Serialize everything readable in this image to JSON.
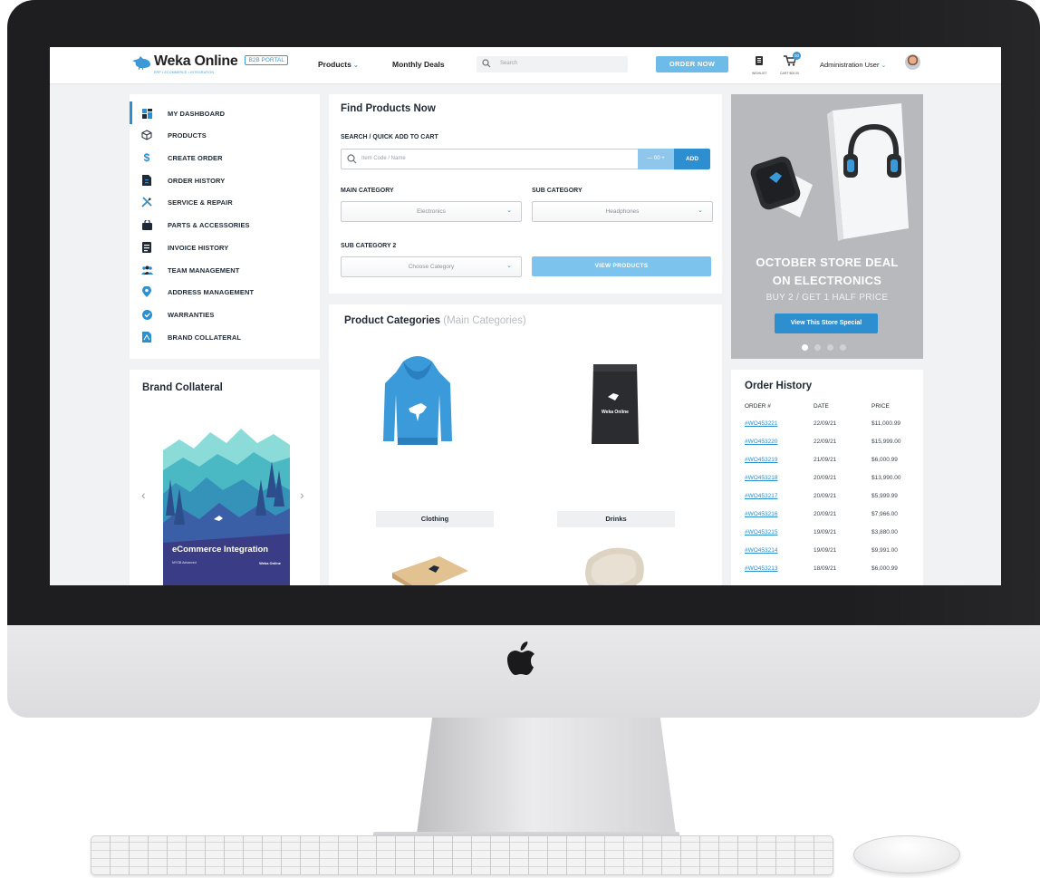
{
  "header": {
    "logo_text": "Weka Online",
    "logo_tagline": "ERP • ECOMMERCE • INTEGRATION",
    "portal_badge": "B2B PORTAL",
    "nav_products": "Products",
    "nav_monthly_deals": "Monthly Deals",
    "search_placeholder": "Search",
    "order_now": "ORDER NOW",
    "wishlist_label": "WISHLIST",
    "cart_label": "CART $00.00",
    "cart_count": "00",
    "user_name": "Administration User"
  },
  "sidebar": {
    "items": [
      {
        "label": "MY DASHBOARD",
        "icon": "dashboard-icon"
      },
      {
        "label": "PRODUCTS",
        "icon": "box-icon"
      },
      {
        "label": "CREATE ORDER",
        "icon": "dollar-icon"
      },
      {
        "label": "ORDER HISTORY",
        "icon": "document-icon"
      },
      {
        "label": "SERVICE & REPAIR",
        "icon": "tools-icon"
      },
      {
        "label": "PARTS & ACCESSORIES",
        "icon": "bag-icon"
      },
      {
        "label": "INVOICE HISTORY",
        "icon": "invoice-icon"
      },
      {
        "label": "TEAM MANAGEMENT",
        "icon": "team-icon"
      },
      {
        "label": "ADDRESS MANAGEMENT",
        "icon": "location-pin-icon"
      },
      {
        "label": "WARRANTIES",
        "icon": "check-circle-icon"
      },
      {
        "label": "BRAND COLLATERAL",
        "icon": "pdf-icon"
      }
    ]
  },
  "brand_collateral": {
    "title": "Brand Collateral",
    "poster_caption": "eCommerce Integration",
    "poster_subtext": "MYOB Advanced",
    "poster_logo": "Weka Online"
  },
  "find_products": {
    "title": "Find Products Now",
    "search_label": "SEARCH / QUICK ADD TO CART",
    "search_placeholder": "Item Code / Name",
    "qty_text": "—  00  +",
    "add_label": "ADD",
    "main_category_label": "MAIN CATEGORY",
    "main_category_value": "Electronics",
    "sub_category_label": "SUB CATEGORY",
    "sub_category_value": "Headphones",
    "sub_category2_label": "SUB CATEGORY 2",
    "sub_category2_value": "Choose Category",
    "view_products": "VIEW PRODUCTS"
  },
  "product_categories": {
    "title": "Product Categories",
    "subtitle": "(Main Categories)",
    "items": [
      {
        "label": "Clothing"
      },
      {
        "label": "Drinks"
      }
    ]
  },
  "promo": {
    "line1": "OCTOBER STORE DEAL",
    "line2": "ON ELECTRONICS",
    "line3": "BUY 2 / GET 1 HALF PRICE",
    "button": "View This Store Special",
    "slide_count": 4,
    "active_slide": 1
  },
  "order_history": {
    "title": "Order History",
    "columns": [
      "ORDER #",
      "DATE",
      "PRICE"
    ],
    "rows": [
      {
        "order": "#WO453221",
        "date": "22/09/21",
        "price": "$11,000.99"
      },
      {
        "order": "#WO453220",
        "date": "22/09/21",
        "price": "$15,999.00"
      },
      {
        "order": "#WO453219",
        "date": "21/09/21",
        "price": "$6,000.99"
      },
      {
        "order": "#WO453218",
        "date": "20/09/21",
        "price": "$13,990.00"
      },
      {
        "order": "#WO453217",
        "date": "20/09/21",
        "price": "$5,999.99"
      },
      {
        "order": "#WO453216",
        "date": "20/09/21",
        "price": "$7,966.00"
      },
      {
        "order": "#WO453215",
        "date": "19/09/21",
        "price": "$3,880.00"
      },
      {
        "order": "#WO453214",
        "date": "19/09/21",
        "price": "$9,991.00"
      },
      {
        "order": "#WO453213",
        "date": "18/09/21",
        "price": "$6,000.99"
      }
    ]
  },
  "colors": {
    "accent": "#2e8fd0",
    "accent_light": "#7cc3ee",
    "bezel": "#1e1e20",
    "page_bg": "#f1f2f4"
  }
}
